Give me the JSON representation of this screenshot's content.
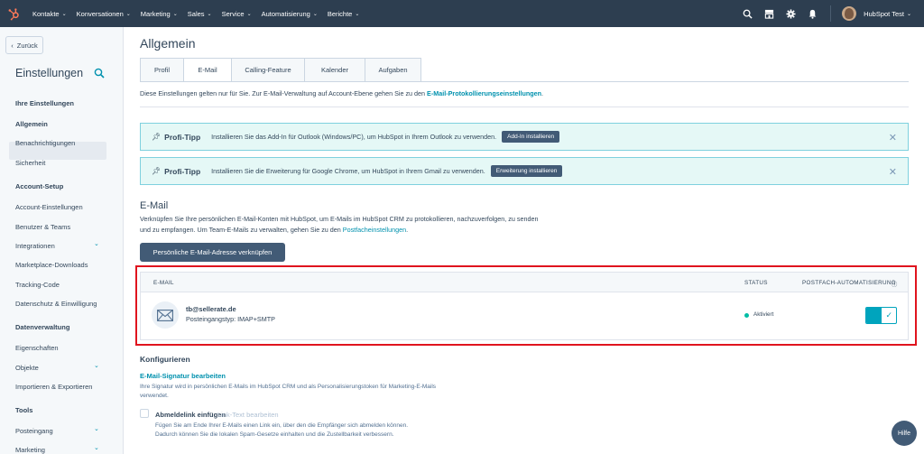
{
  "topnav": {
    "items": [
      {
        "label": "Kontakte"
      },
      {
        "label": "Konversationen"
      },
      {
        "label": "Marketing"
      },
      {
        "label": "Sales"
      },
      {
        "label": "Service"
      },
      {
        "label": "Automatisierung"
      },
      {
        "label": "Berichte"
      }
    ],
    "user_name": "HubSpot Test"
  },
  "sidebar": {
    "back_label": "Zurück",
    "title": "Einstellungen",
    "groups": [
      {
        "label": "Ihre Einstellungen",
        "items": [
          "Allgemein",
          "Benachrichtigungen",
          "Sicherheit"
        ]
      },
      {
        "label": "Account-Setup",
        "items": [
          "Account-Einstellungen",
          "Benutzer & Teams",
          "Integrationen",
          "Marketplace-Downloads",
          "Tracking-Code",
          "Datenschutz & Einwilligung"
        ]
      },
      {
        "label": "Datenverwaltung",
        "items": [
          "Eigenschaften",
          "Objekte",
          "Importieren & Exportieren"
        ]
      },
      {
        "label": "Tools",
        "items": [
          "Posteingang",
          "Marketing"
        ]
      }
    ]
  },
  "main": {
    "title": "Allgemein",
    "tabs": [
      {
        "label": "Profil"
      },
      {
        "label": "E-Mail"
      },
      {
        "label": "Calling-Feature"
      },
      {
        "label": "Kalender"
      },
      {
        "label": "Aufgaben"
      }
    ],
    "intro_text": "Diese Einstellungen gelten nur für Sie. Zur E-Mail-Verwaltung auf Account-Ebene gehen Sie zu den ",
    "intro_link": "E-Mail-Protokollierungseinstellungen",
    "intro_end": ".",
    "tips": [
      {
        "label": "Profi-Tipp",
        "text": "Installieren Sie das Add-In für Outlook (Windows/PC), um HubSpot in Ihrem Outlook zu verwenden.",
        "button": "Add-In installieren"
      },
      {
        "label": "Profi-Tipp",
        "text": "Installieren Sie die Erweiterung für Google Chrome, um HubSpot in Ihrem Gmail zu verwenden.",
        "button": "Erweiterung installieren"
      }
    ],
    "email_section": {
      "title": "E-Mail",
      "desc_1": "Verknüpfen Sie Ihre persönlichen E-Mail-Konten mit HubSpot, um E-Mails im HubSpot CRM zu protokollieren, nachzuverfolgen, zu senden",
      "desc_2": "und zu empfangen. Um Team-E-Mails zu verwalten, gehen Sie zu den ",
      "desc_link": "Postfacheinstellungen",
      "desc_end": ".",
      "connect_button": "Persönliche E-Mail-Adresse verknüpfen",
      "table": {
        "col_email": "E-MAIL",
        "col_status": "STATUS",
        "col_automation": "POSTFACH-AUTOMATISIERUNG",
        "row": {
          "email": "tb@sellerate.de",
          "type": "Posteingangstyp: IMAP+SMTP",
          "status": "Aktiviert",
          "automation_enabled": true
        }
      }
    },
    "configure": {
      "title": "Konfigurieren",
      "signature_link": "E-Mail-Signatur bearbeiten",
      "signature_desc": "Ihre Signatur wird in persönlichen E-Mails im HubSpot CRM und als Personalisierungstoken für Marketing-E-Mails verwendet.",
      "unsubscribe_label": "Abmeldelink einfügen",
      "unsubscribe_link": "Link-Text bearbeiten",
      "unsubscribe_desc": "Fügen Sie am Ende Ihrer E-Mails einen Link ein, über den die Empfänger sich abmelden können. Dadurch können Sie die lokalen Spam-Gesetze einhalten und die Zustellbarkeit verbessern."
    },
    "help_button": "Hilfe"
  },
  "colors": {
    "nav_bg": "#2d3e50",
    "accent": "#0091ae",
    "tip_bg": "#e5f8f6",
    "highlight_box": "#e0141e",
    "status_active": "#00bda5"
  }
}
